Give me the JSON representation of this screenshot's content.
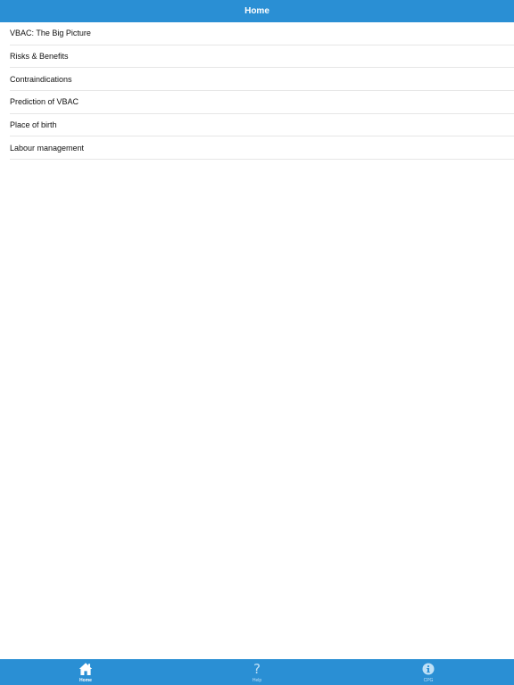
{
  "navbar": {
    "title": "Home"
  },
  "menu": {
    "items": [
      {
        "label": "VBAC: The Big Picture"
      },
      {
        "label": "Risks & Benefits"
      },
      {
        "label": "Contraindications"
      },
      {
        "label": "Prediction of VBAC"
      },
      {
        "label": "Place of birth"
      },
      {
        "label": "Labour management"
      }
    ]
  },
  "tabbar": {
    "tabs": [
      {
        "label": "Home",
        "icon": "home-icon",
        "active": true
      },
      {
        "label": "Help",
        "icon": "help-icon",
        "glyph": "?",
        "active": false
      },
      {
        "label": "CPG",
        "icon": "info-icon",
        "active": false
      }
    ]
  },
  "colors": {
    "accent": "#2a8fd4",
    "divider": "#e6e6e6",
    "inactive_tab": "#bfe0f6"
  }
}
